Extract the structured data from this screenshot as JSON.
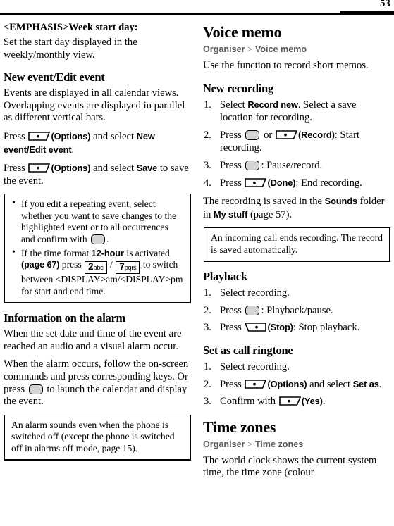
{
  "header": {
    "page_number": "53"
  },
  "left_column": {
    "setting_title": "<EMPHASIS>Week start day:",
    "setting_desc": "Set the start day displayed in the weekly/monthly view.",
    "new_event_heading": "New event/Edit event",
    "new_event_p1": "Events are displayed in all calendar views. Overlapping events are displayed in parallel as different vertical bars.",
    "press_1_pre": "Press",
    "press_1_options": "(Options)",
    "press_1_mid": "and select",
    "press_1_item": "New event/Edit event",
    "press_1_end": ".",
    "press_2_pre": "Press",
    "press_2_options": "(Options)",
    "press_2_mid": "and select",
    "press_2_item": "Save",
    "press_2_end": "to save the event.",
    "note_bullets": [
      {
        "before": "If you edit a repeating event, select whether you want to save changes to the highlighted event or to all occurrences and confirm with",
        "after": "."
      },
      {
        "part1": "If the time format",
        "bold1": "12-hour",
        "part2": "is activated",
        "part3": "(page 67)",
        "part4": "press",
        "key_a_digit": "2",
        "key_a_letters": "abc",
        "slash": "/",
        "key_b_digit": "7",
        "key_b_letters": "pqrs",
        "part5": "to switch between <DISPLAY>am/<DISPLAY>pm for start and end time."
      }
    ],
    "alarm_heading": "Information on the alarm",
    "alarm_p1": "When the set date and time of the event are reached an audio and a visual alarm occur.",
    "alarm_p2_pre": "When the alarm occurs, follow the on-screen commands and press corresponding keys. Or press",
    "alarm_p2_post": "to launch the calendar and display the event.",
    "alarm_note": "An alarm sounds even when the phone is switched off (except the phone is switched off in alarms off mode, page 15)."
  },
  "right_column": {
    "voice_memo_title": "Voice memo",
    "voice_memo_crumb_1": "Organiser",
    "voice_memo_crumb_sep": ">",
    "voice_memo_crumb_2": "Voice memo",
    "voice_memo_desc": "Use the function to record short memos.",
    "new_recording_heading": "New recording",
    "new_recording_steps": [
      {
        "pre": "Select",
        "bold": "Record new",
        "post": ". Select a save location for recording."
      },
      {
        "pre": "Press",
        "mid": "or",
        "label": "(Record)",
        "post": ": Start recording."
      },
      {
        "pre": "Press",
        "post": ": Pause/record."
      },
      {
        "pre": "Press",
        "label": "(Done)",
        "post": ": End recording."
      }
    ],
    "saved_pre": "The recording is saved in the",
    "saved_bold1": "Sounds",
    "saved_mid": "folder in",
    "saved_bold2": "My stuff",
    "saved_post": "(page 57).",
    "incoming_note": "An incoming call ends recording. The record is saved automatically.",
    "playback_heading": "Playback",
    "playback_steps": [
      {
        "text": "Select recording."
      },
      {
        "pre": "Press",
        "post": ": Playback/pause."
      },
      {
        "pre": "Press",
        "label": "(Stop)",
        "post": ": Stop playback."
      }
    ],
    "ringtone_heading": "Set as call ringtone",
    "ringtone_steps": [
      {
        "text": "Select recording."
      },
      {
        "pre": "Press",
        "label": "(Options)",
        "mid": "and select",
        "bold": "Set as",
        "post": "."
      },
      {
        "pre": "Confirm with",
        "label": "(Yes)",
        "post": "."
      }
    ],
    "time_zones_title": "Time zones",
    "time_zones_crumb_1": "Organiser",
    "time_zones_crumb_sep": ">",
    "time_zones_crumb_2": "Time zones",
    "time_zones_desc": "The world clock shows the current system time, the time zone (colour"
  },
  "icons": {
    "soft_key_left": "left-softkey-icon",
    "soft_key_right": "right-softkey-icon",
    "select_key": "center-select-key-icon",
    "key_2": "keypad-2-icon",
    "key_7": "keypad-7-icon"
  },
  "colors": {
    "ink": "#000000",
    "crumb": "#58585a",
    "key_fill": "#d4d4d4"
  }
}
